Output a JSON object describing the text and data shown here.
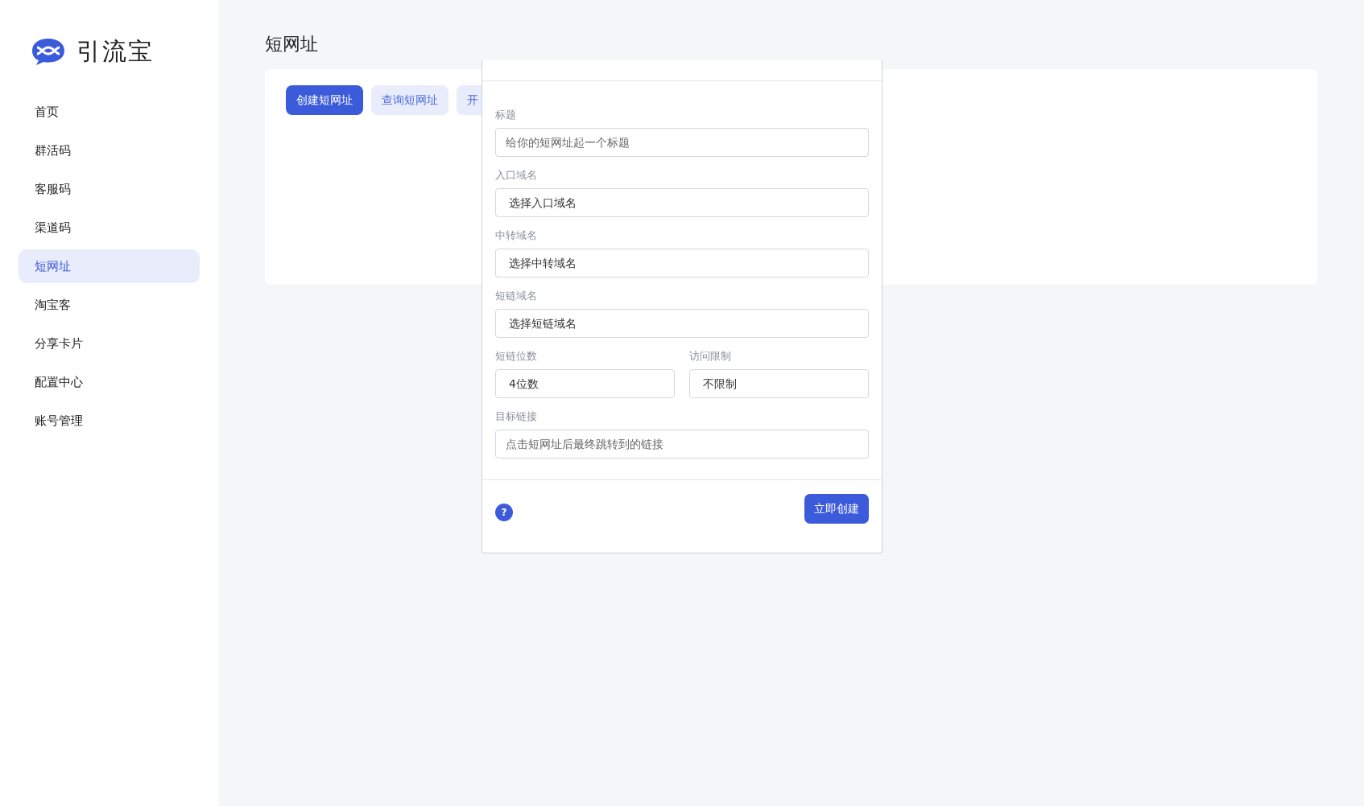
{
  "sidebar": {
    "brand": "引流宝",
    "items": [
      {
        "label": "首页",
        "selected": false
      },
      {
        "label": "群活码",
        "selected": false
      },
      {
        "label": "客服码",
        "selected": false
      },
      {
        "label": "渠道码",
        "selected": false
      },
      {
        "label": "短网址",
        "selected": true
      },
      {
        "label": "淘宝客",
        "selected": false
      },
      {
        "label": "分享卡片",
        "selected": false
      },
      {
        "label": "配置中心",
        "selected": false
      },
      {
        "label": "账号管理",
        "selected": false
      }
    ]
  },
  "page_title": "短网址",
  "actions": [
    {
      "label": "创建短网址",
      "selected": true
    },
    {
      "label": "查询短网址",
      "selected": false
    },
    {
      "label": "开",
      "selected": false
    }
  ],
  "dialog": {
    "fields": [
      {
        "kind": "input",
        "label": "标题",
        "placeholder": "给你的短网址起一个标题"
      },
      {
        "kind": "select",
        "label": "入口域名",
        "value": "选择入口域名"
      },
      {
        "kind": "select",
        "label": "中转域名",
        "value": "选择中转域名"
      },
      {
        "kind": "select",
        "label": "短链域名",
        "value": "选择短链域名"
      },
      {
        "kind": "pair",
        "items": [
          {
            "label": "短链位数",
            "value": "4位数"
          },
          {
            "label": "访问限制",
            "value": "不限制"
          }
        ]
      },
      {
        "kind": "input",
        "label": "目标链接",
        "placeholder": "点击短网址后最终跳转到的链接"
      }
    ],
    "help": "?",
    "submit": "立即创建"
  }
}
